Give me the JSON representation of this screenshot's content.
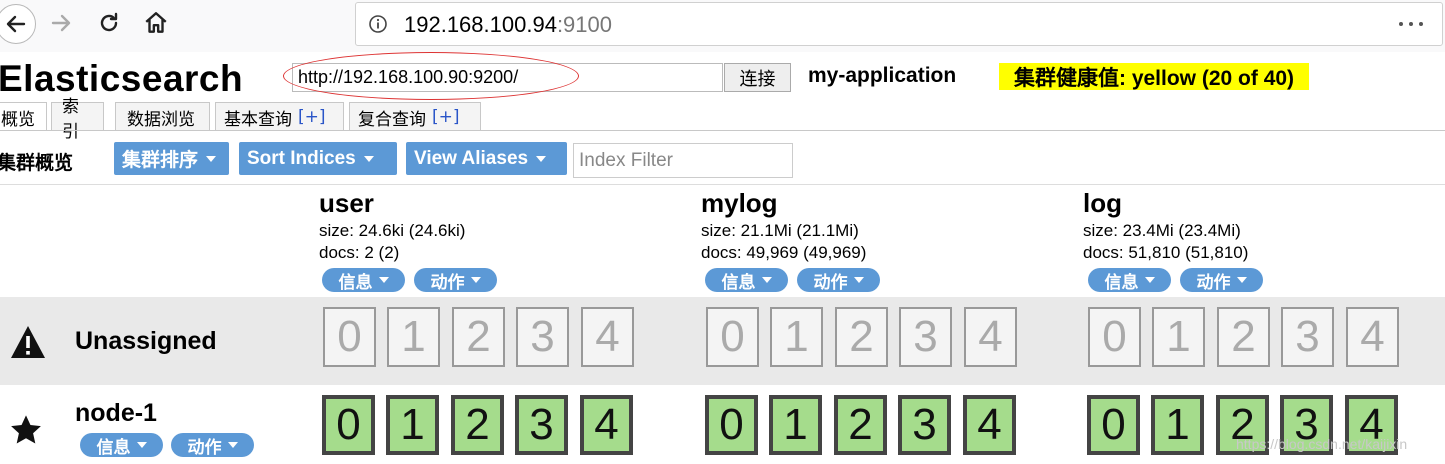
{
  "browser": {
    "url_host": "192.168.100.94",
    "url_port": ":9100"
  },
  "app": {
    "title": "Elasticsearch",
    "cluster_url": "http://192.168.100.90:9200/",
    "connect_label": "连接",
    "cluster_name": "my-application",
    "health_text": "集群健康值: yellow (20 of 40)",
    "health_color": "#ffff00"
  },
  "tabs": [
    {
      "label": "概览"
    },
    {
      "label": "索引"
    },
    {
      "label": "数据浏览"
    },
    {
      "label": "基本查询",
      "plus": "[+]"
    },
    {
      "label": "复合查询",
      "plus": "[+]"
    }
  ],
  "toolbar": {
    "title": "集群概览",
    "sort_cluster_label": "集群排序",
    "sort_indices_label": "Sort Indices",
    "view_aliases_label": "View Aliases",
    "filter_placeholder": "Index Filter"
  },
  "indices": [
    {
      "name": "user",
      "size": "size: 24.6ki (24.6ki)",
      "docs": "docs: 2 (2)",
      "info_label": "信息",
      "action_label": "动作"
    },
    {
      "name": "mylog",
      "size": "size: 21.1Mi (21.1Mi)",
      "docs": "docs: 49,969 (49,969)",
      "info_label": "信息",
      "action_label": "动作"
    },
    {
      "name": "log",
      "size": "size: 23.4Mi (23.4Mi)",
      "docs": "docs: 51,810 (51,810)",
      "info_label": "信息",
      "action_label": "动作"
    }
  ],
  "rows": {
    "unassigned": {
      "label": "Unassigned",
      "icon": "warning-icon"
    },
    "node": {
      "label": "node-1",
      "icon": "star-icon",
      "info_label": "信息",
      "action_label": "动作"
    }
  },
  "shards": [
    "0",
    "1",
    "2",
    "3",
    "4"
  ],
  "colors": {
    "button_blue": "#5c99d6",
    "shard_assigned": "#a5dc8c"
  },
  "watermark": "https://blog.csdn.net/kaijixin"
}
